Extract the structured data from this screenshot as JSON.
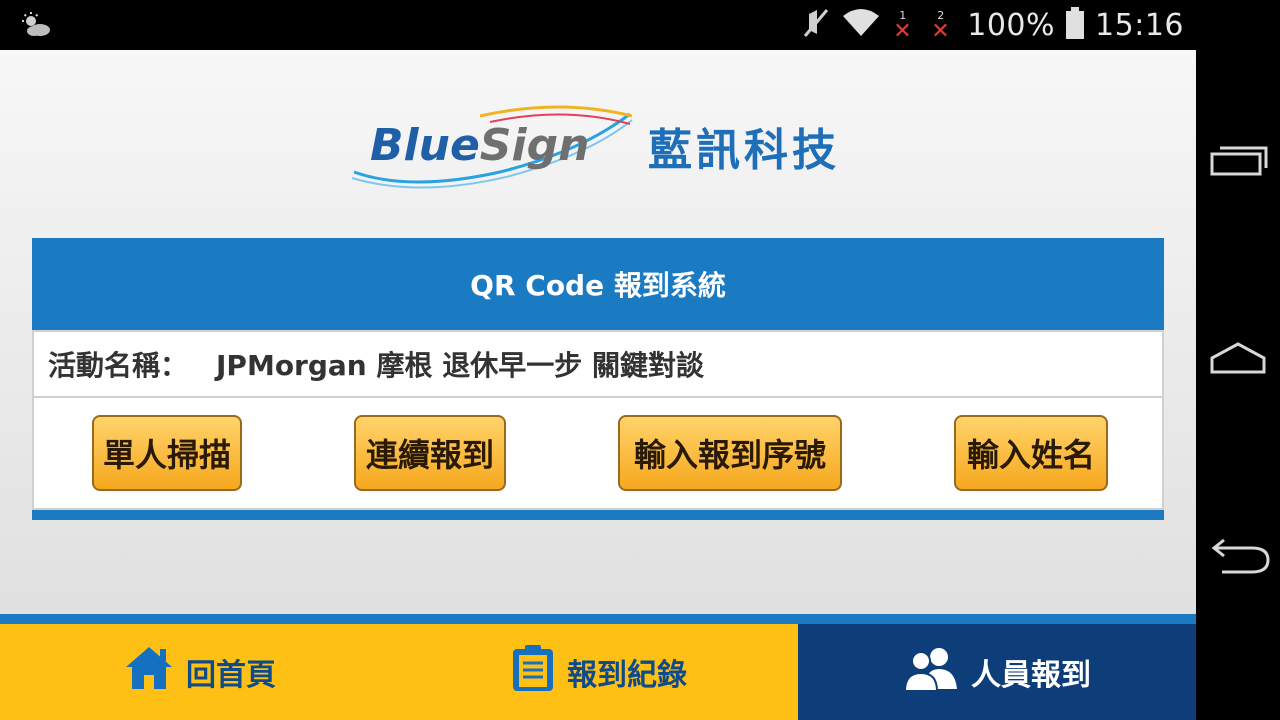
{
  "status_bar": {
    "battery": "100%",
    "time": "15:16",
    "sim1": "1",
    "sim2": "2"
  },
  "logo": {
    "en": "BlueSign",
    "zh": "藍訊科技"
  },
  "panel": {
    "title": "QR Code 報到系統",
    "event_label": "活動名稱：",
    "event_name": "JPMorgan 摩根 退休早一步 關鍵對談"
  },
  "buttons": {
    "single_scan": "單人掃描",
    "continuous": "連續報到",
    "enter_number": "輸入報到序號",
    "enter_name": "輸入姓名"
  },
  "tabs": {
    "home": "回首頁",
    "records": "報到紀錄",
    "checkin": "人員報到"
  },
  "colors": {
    "header_blue": "#1b7bc2",
    "tab_yellow": "#fec015",
    "tab_active": "#0d3e7a",
    "button_orange": "#f6a81e"
  }
}
